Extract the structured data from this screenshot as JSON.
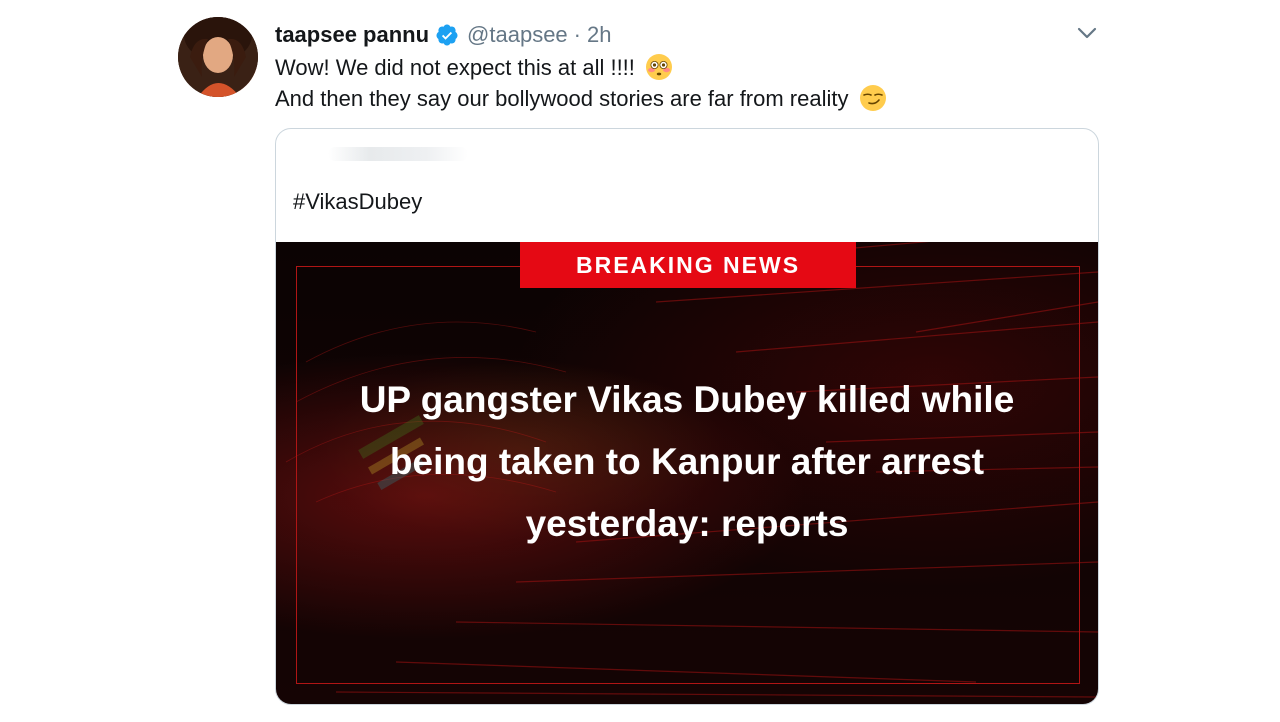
{
  "tweet": {
    "author_name": "taapsee pannu",
    "author_handle": "@taapsee",
    "separator": "·",
    "time": "2h",
    "line1": "Wow! We did not expect this at all !!!!",
    "line2": "And then they say our bollywood stories are far from reality",
    "emoji1": "flushed-face",
    "emoji2": "smirking-face"
  },
  "card": {
    "hashtag": "#VikasDubey",
    "badge": "BREAKING NEWS",
    "headline": "UP gangster Vikas Dubey killed while being taken to Kanpur after arrest yesterday: reports"
  },
  "colors": {
    "verified": "#1da1f2",
    "badge": "#e50914",
    "secondary_text": "#657786"
  },
  "icons": [
    "verified-badge-icon",
    "chevron-down-icon",
    "flushed-face-emoji-icon",
    "smirking-face-emoji-icon"
  ]
}
